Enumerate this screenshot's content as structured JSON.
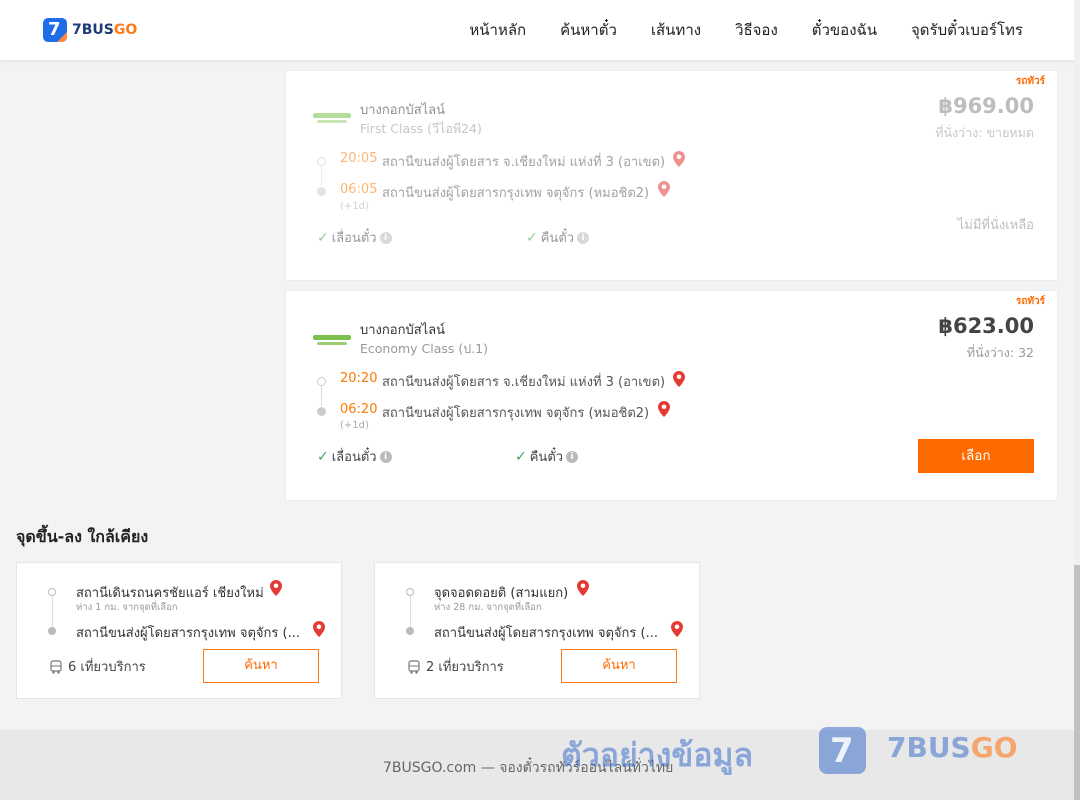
{
  "brand": {
    "logo_glyph": "7",
    "name_main": "7BUS",
    "name_accent": "GO"
  },
  "nav": {
    "items": [
      {
        "label": "หน้าหลัก"
      },
      {
        "label": "ค้นหาตั๋ว"
      },
      {
        "label": "เส้นทาง"
      },
      {
        "label": "วิธีจอง"
      },
      {
        "label": "ตั๋วของฉัน"
      },
      {
        "label": "จุดรับตั๋วเบอร์โทร"
      }
    ]
  },
  "trips": [
    {
      "badge": "รถทัวร์",
      "operator": "บางกอกบัสไลน์",
      "class": "First Class (วีไอพี24)",
      "price": "฿969.00",
      "seats": "ที่นั่งว่าง: ขายหมด",
      "depart_time": "20:05",
      "depart_station": "สถานีขนส่งผู้โดยสาร จ.เชียงใหม่ แห่งที่ 3 (อาเขต)",
      "arrive_time": "06:05",
      "arrive_station": "สถานีขนส่งผู้โดยสารกรุงเทพ จตุจักร (หมอชิต2)",
      "day_offset": "(+1d)",
      "feature_1": "เลื่อนตั๋ว",
      "feature_2": "คืนตั๋ว",
      "status": "ไม่มีที่นั่งเหลือ"
    },
    {
      "badge": "รถทัวร์",
      "operator": "บางกอกบัสไลน์",
      "class": "Economy Class (ป.1)",
      "price": "฿623.00",
      "seats": "ที่นั่งว่าง: 32",
      "depart_time": "20:20",
      "depart_station": "สถานีขนส่งผู้โดยสาร จ.เชียงใหม่ แห่งที่ 3 (อาเขต)",
      "arrive_time": "06:20",
      "arrive_station": "สถานีขนส่งผู้โดยสารกรุงเทพ จตุจักร (หมอชิต2)",
      "day_offset": "(+1d)",
      "feature_1": "เลื่อนตั๋ว",
      "feature_2": "คืนตั๋ว",
      "action": "เลือก"
    }
  ],
  "nearby": {
    "title": "จุดขึ้น-ลง ใกล้เคียง",
    "cards": [
      {
        "from": "สถานีเดินรถนครชัยแอร์ เชียงใหม่",
        "distance": "ห่าง 1 กม. จากจุดที่เลือก",
        "to": "สถานีขนส่งผู้โดยสารกรุงเทพ จตุจักร (...",
        "trips": "6 เที่ยวบริการ",
        "action": "ค้นหา"
      },
      {
        "from": "จุดจอดดอยติ (สามแยก)",
        "distance": "ห่าง 28 กม. จากจุดที่เลือก",
        "to": "สถานีขนส่งผู้โดยสารกรุงเทพ จตุจักร (...",
        "trips": "2 เที่ยวบริการ",
        "action": "ค้นหา"
      }
    ]
  },
  "footer": {
    "text": "7BUSGO.com — จองตั๋วรถทัวร์ออนไลน์ทั่วไทย"
  },
  "watermark": {
    "text": "ตัวอย่างข้อมูล",
    "logo_glyph": "7",
    "brand_main": "7BUS",
    "brand_accent": "GO"
  },
  "colors": {
    "accent": "#ff6a00",
    "brand_blue": "#1f6ee8",
    "pin": "#e53935",
    "check": "#3fa65a"
  },
  "icons": [
    "map-pin-icon",
    "check-icon",
    "info-icon",
    "bus-icon"
  ]
}
